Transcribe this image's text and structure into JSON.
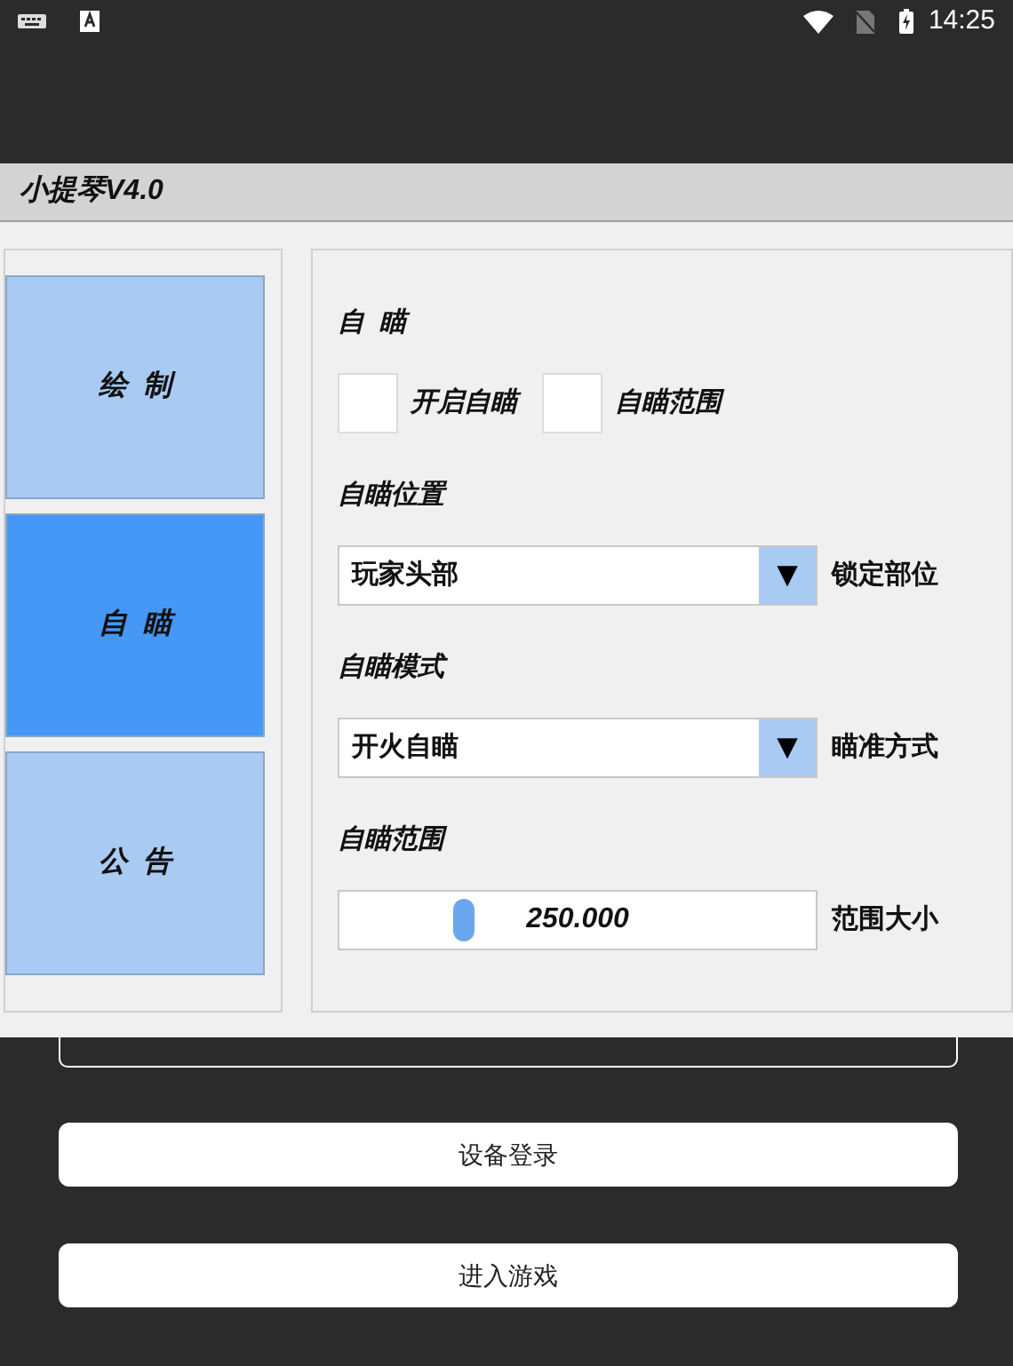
{
  "status_bar": {
    "time": "14:25"
  },
  "window": {
    "title": "小提琴V4.0"
  },
  "sidebar": {
    "tabs": [
      {
        "label": "绘  制",
        "selected": false
      },
      {
        "label": "自  瞄",
        "selected": true
      },
      {
        "label": "公  告",
        "selected": false
      }
    ]
  },
  "panel": {
    "heading": "自  瞄",
    "checkboxes": [
      {
        "label": "开启自瞄",
        "checked": false
      },
      {
        "label": "自瞄范围",
        "checked": false
      }
    ],
    "settings": [
      {
        "kind": "dropdown",
        "title": "自瞄位置",
        "value": "玩家头部",
        "arrow": "▼",
        "label": "锁定部位"
      },
      {
        "kind": "dropdown",
        "title": "自瞄模式",
        "value": "开火自瞄",
        "arrow": "▼",
        "label": "瞄准方式"
      },
      {
        "kind": "slider",
        "title": "自瞄范围",
        "value": "250.000",
        "level": 0.26,
        "label": "范围大小"
      }
    ]
  },
  "background_form": {
    "buttons": [
      "设备登录",
      "进入游戏"
    ]
  }
}
